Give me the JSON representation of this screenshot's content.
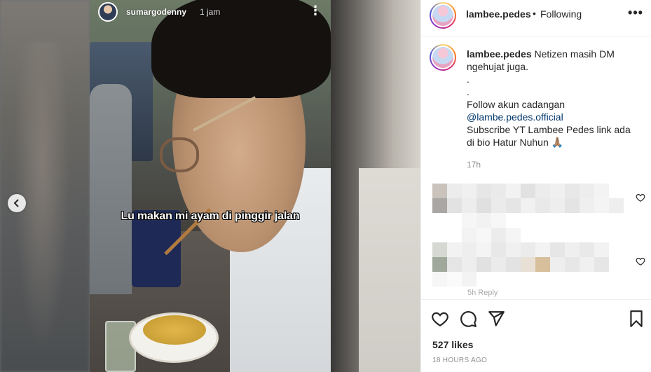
{
  "story": {
    "username": "sumargodenny",
    "time": "1 jam",
    "menu_icon": "⋮",
    "subtitle": "Lu makan mi ayam di pinggir jalan"
  },
  "post": {
    "username": "lambee.pedes",
    "dot": "•",
    "follow_status": "Following",
    "more_icon": "•••"
  },
  "caption": {
    "username": "lambee.pedes",
    "line1": "Netizen masih DM",
    "line2": "ngehujat juga.",
    "line3": ".",
    "line4": ".",
    "line5": "Follow akun cadangan",
    "mention": "@lambe.pedes.official",
    "line7": "Subscribe YT Lambee Pedes link ada",
    "line8": "di bio Hatur Nuhun 🙏🏽",
    "time": "17h"
  },
  "comments": {
    "reply_meta": "5h    Reply"
  },
  "stats": {
    "likes": "527 likes",
    "posted": "18 HOURS AGO"
  },
  "colors": {
    "text": "#262626",
    "secondary": "#8e8e8e",
    "link": "#00376b",
    "border": "#efefef"
  }
}
